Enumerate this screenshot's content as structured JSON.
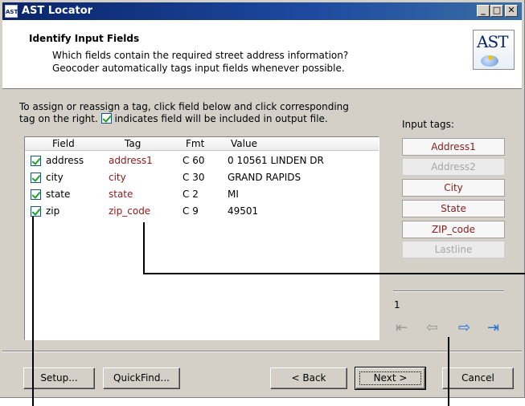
{
  "window": {
    "title": "AST Locator",
    "icon_text": "AST"
  },
  "title_buttons": {
    "minimize": "_",
    "maximize": "□",
    "close": "✕"
  },
  "header": {
    "title": "Identify Input Fields",
    "desc_line1": "Which fields contain the required street address information?",
    "desc_line2": "Geocoder automatically tags input fields whenever possible.",
    "logo_text": "AST"
  },
  "instructions": {
    "line1": "To assign or reassign a tag, click field below and click corresponding",
    "line2_pre": "tag on the right.",
    "line2_post": "indicates field will be included in output file."
  },
  "grid": {
    "columns": {
      "field": "Field",
      "tag": "Tag",
      "fmt": "Fmt",
      "value": "Value"
    },
    "rows": [
      {
        "field": "address",
        "tag": "address1",
        "fmt": "C 60",
        "value": "0 10561 LINDEN DR",
        "checked": true
      },
      {
        "field": "city",
        "tag": "city",
        "fmt": "C 30",
        "value": "GRAND RAPIDS",
        "checked": true
      },
      {
        "field": "state",
        "tag": "state",
        "fmt": "C 2",
        "value": "MI",
        "checked": true
      },
      {
        "field": "zip",
        "tag": "zip_code",
        "fmt": "C 9",
        "value": "49501",
        "checked": true
      }
    ]
  },
  "input_tags": {
    "label": "Input tags:",
    "items": [
      {
        "label": "Address1",
        "enabled": true
      },
      {
        "label": "Address2",
        "enabled": false
      },
      {
        "label": "City",
        "enabled": true
      },
      {
        "label": "State",
        "enabled": true
      },
      {
        "label": "ZIP_code",
        "enabled": true
      },
      {
        "label": "Lastline",
        "enabled": false
      }
    ]
  },
  "record": {
    "number": "1"
  },
  "nav": {
    "first": "first-record-icon",
    "prev": "prev-record-icon",
    "next": "next-record-icon",
    "last": "last-record-icon"
  },
  "buttons": {
    "setup": "Setup...",
    "quickfind": "QuickFind...",
    "back": "< Back",
    "next": "Next >",
    "cancel": "Cancel"
  },
  "colors": {
    "tag_text": "#8b1a1a",
    "title_bar": "#0a246a",
    "nav_active": "#1e73d8",
    "checkmark": "#21a121"
  }
}
